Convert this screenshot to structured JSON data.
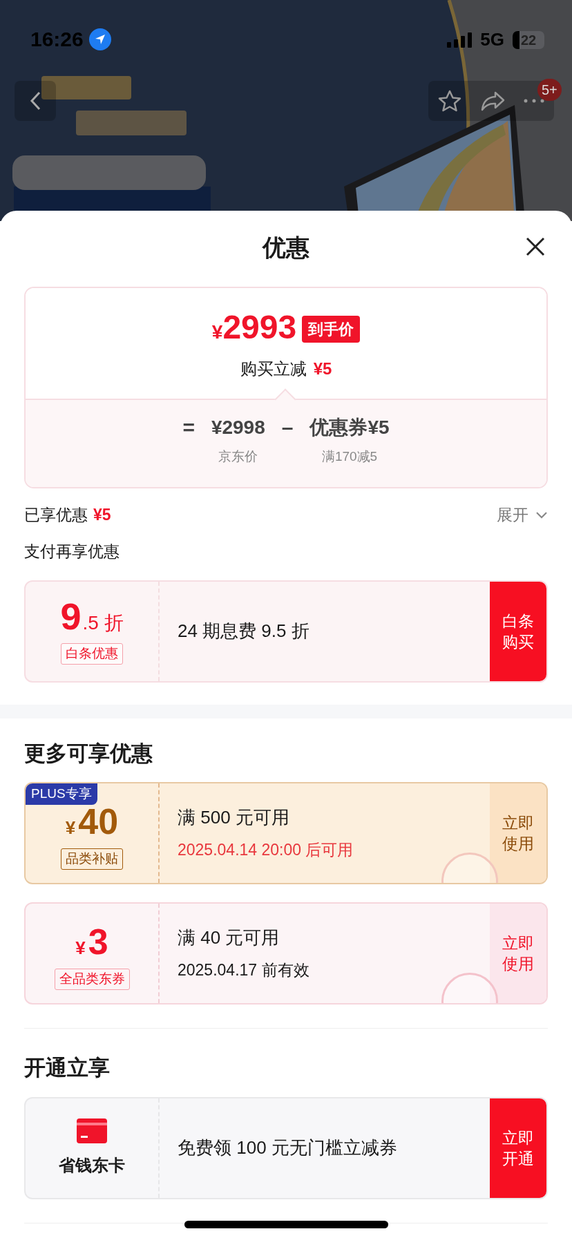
{
  "status_bar": {
    "time": "16:26",
    "network": "5G",
    "battery": "22"
  },
  "nav": {
    "badge": "5+"
  },
  "sheet": {
    "title": "优惠"
  },
  "price_card": {
    "price_symbol": "¥",
    "price": "2993",
    "price_tag": "到手价",
    "reduction_label": "购买立减",
    "reduction": "¥5",
    "formula": [
      {
        "kind": "operator",
        "text": "="
      },
      {
        "kind": "term",
        "value": "¥2998",
        "caption": "京东价"
      },
      {
        "kind": "operator",
        "text": "–"
      },
      {
        "kind": "term",
        "value": "优惠券¥5",
        "caption": "满170减5"
      }
    ]
  },
  "savings": {
    "label": "已享优惠",
    "amount": "¥5",
    "toggle": "展开",
    "expanded": false
  },
  "payment": {
    "heading": "支付再享优惠",
    "offers": [
      {
        "big": "9",
        "small": ".5 折",
        "tag": "白条优惠",
        "text": "24 期息费 9.5 折",
        "action": "白条购买"
      }
    ]
  },
  "more": {
    "heading": "更多可享优惠",
    "coupons": [
      {
        "kind": "plus",
        "badge": "PLUS专享",
        "symbol": "¥",
        "amount": "40",
        "tag": "品类补贴",
        "condition": "满 500 元可用",
        "validity": "2025.04.14 20:00 后可用",
        "validity_highlight": true,
        "claimed": true,
        "action": "立即使用"
      },
      {
        "kind": "standard",
        "symbol": "¥",
        "amount": "3",
        "tag": "全品类东券",
        "condition": "满 40 元可用",
        "validity": "2025.04.17 前有效",
        "validity_highlight": false,
        "claimed": true,
        "action": "立即使用"
      }
    ]
  },
  "membership": {
    "heading": "开通立享",
    "offers": [
      {
        "name": "省钱东卡",
        "text": "免费领 100 元无门槛立减券",
        "action": "立即开通"
      }
    ]
  }
}
